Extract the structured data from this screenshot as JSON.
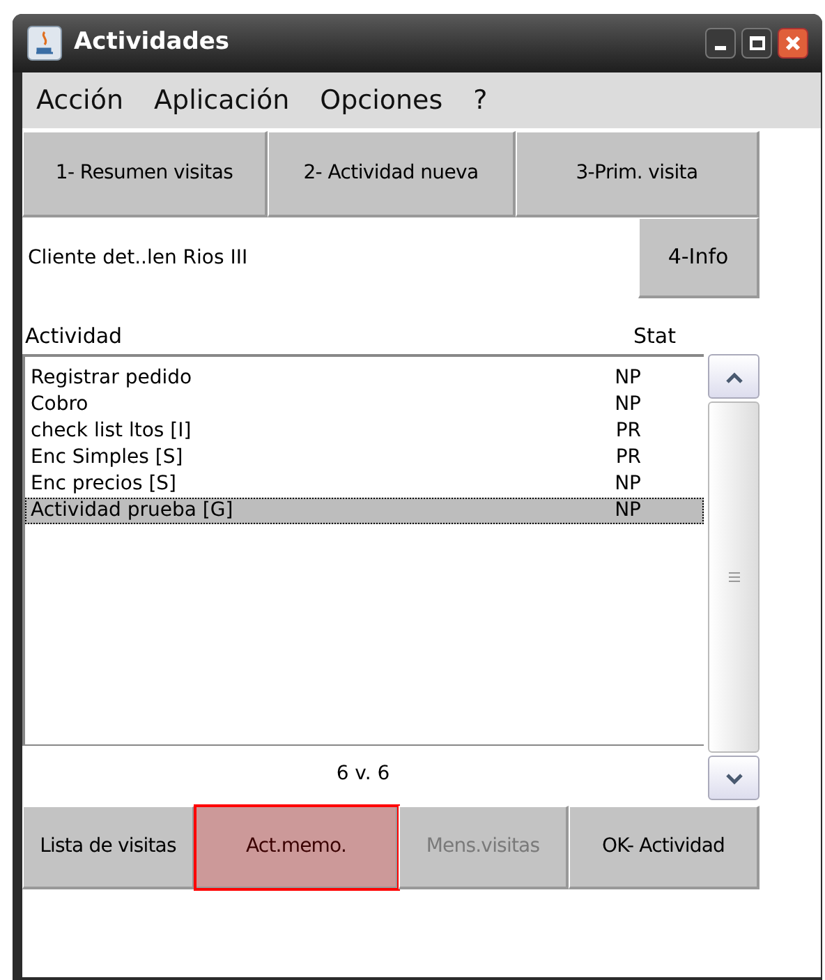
{
  "window": {
    "title": "Actividades"
  },
  "menu": [
    "Acción",
    "Aplicación",
    "Opciones",
    "?"
  ],
  "top_buttons": [
    {
      "label": "1- Resumen visitas"
    },
    {
      "label": "2- Actividad nueva"
    },
    {
      "label": "3-Prim. visita"
    }
  ],
  "client": {
    "label": "Cliente det..len Rios III",
    "info_button": "4-Info"
  },
  "table": {
    "columns": [
      "Actividad",
      "Stat"
    ],
    "rows": [
      {
        "actividad": "Registrar pedido",
        "stat": "NP",
        "selected": false
      },
      {
        "actividad": "Cobro",
        "stat": "NP",
        "selected": false
      },
      {
        "actividad": "check list ltos [I]",
        "stat": "PR",
        "selected": false
      },
      {
        "actividad": "Enc Simples [S]",
        "stat": "PR",
        "selected": false
      },
      {
        "actividad": "Enc precios [S]",
        "stat": "NP",
        "selected": false
      },
      {
        "actividad": "Actividad prueba [G]",
        "stat": "NP",
        "selected": true
      }
    ]
  },
  "counter": "6 v. 6",
  "bottom_buttons": [
    {
      "label": "Lista de visitas",
      "disabled": false,
      "highlighted": false
    },
    {
      "label": "Act.memo.",
      "disabled": false,
      "highlighted": true
    },
    {
      "label": "Mens.visitas",
      "disabled": true,
      "highlighted": false
    },
    {
      "label": "OK- Actividad",
      "disabled": false,
      "highlighted": false
    }
  ]
}
